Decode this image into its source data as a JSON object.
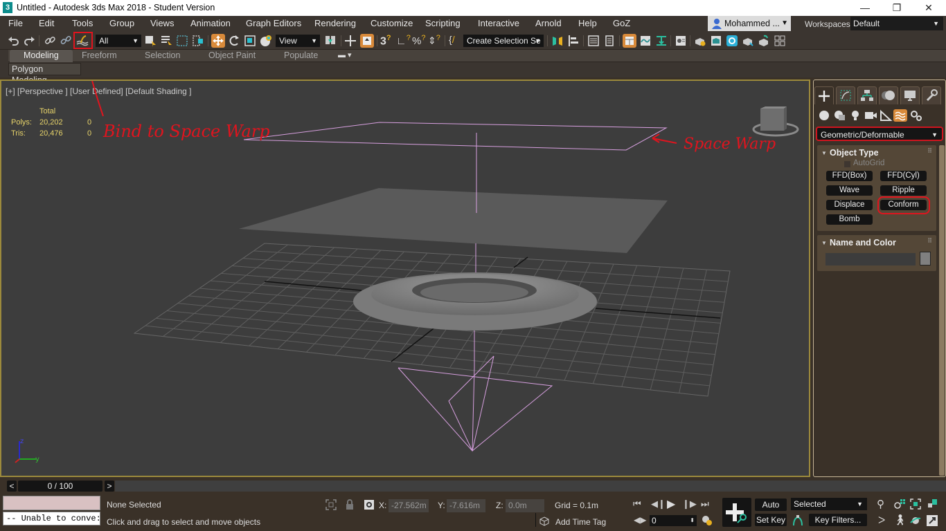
{
  "window": {
    "title": "Untitled - Autodesk 3ds Max 2018 - Student Version",
    "app_icon": "3",
    "minimize": "—",
    "restore": "❐",
    "close": "✕"
  },
  "menu": {
    "items": [
      "File",
      "Edit",
      "Tools",
      "Group",
      "Views",
      "Animation",
      "Graph Editors",
      "Rendering",
      "Customize",
      "Scripting",
      "Interactive",
      "Arnold",
      "Help",
      "GoZ"
    ],
    "user": "Mohammed ...",
    "workspaces_label": "Workspaces:",
    "workspace_value": "Default"
  },
  "toolbar": {
    "selection_filter": "All",
    "ref_coord": "View",
    "named_selection": "Create Selection Se",
    "highlighted_tool": "bind-to-space-warp"
  },
  "ribbon": {
    "tabs": [
      "Modeling",
      "Freeform",
      "Selection",
      "Object Paint",
      "Populate"
    ],
    "active_tab": "Modeling",
    "panel_button": "Polygon Modeling"
  },
  "viewport": {
    "label": "[+] [Perspective ] [User Defined] [Default Shading ]",
    "stats": {
      "header": "Total",
      "rows": [
        {
          "label": "Polys:",
          "total": "20,202",
          "selected": "0"
        },
        {
          "label": "Tris:",
          "total": "20,476",
          "selected": "0"
        }
      ]
    },
    "annotations": {
      "bind": "Bind to Space Warp",
      "warp": "Space Warp"
    },
    "axis": {
      "z": "z",
      "y": "y"
    }
  },
  "command_panel": {
    "category_dropdown": "Geometric/Deformable",
    "object_type": {
      "title": "Object Type",
      "autogrid": "AutoGrid",
      "buttons": [
        "FFD(Box)",
        "FFD(Cyl)",
        "Wave",
        "Ripple",
        "Displace",
        "Conform",
        "Bomb"
      ],
      "highlighted": "Conform"
    },
    "name_color": {
      "title": "Name and Color",
      "name_value": "",
      "swatch_color": "#808080"
    }
  },
  "timeline": {
    "frame": "0 / 100",
    "prev": "<",
    "next": ">"
  },
  "status": {
    "maxscript_output": "-- Unable to conve:",
    "selection": "None Selected",
    "prompt": "Click and drag to select and move objects",
    "x_label": "X:",
    "x_value": "-27.562m",
    "y_label": "Y:",
    "y_value": "-7.616m",
    "z_label": "Z:",
    "z_value": "0.0m",
    "grid": "Grid = 0.1m",
    "add_time_tag": "Add Time Tag",
    "auto_key": "Auto Key",
    "set_key": "Set Key",
    "key_mode": "Selected",
    "key_filters": "Key Filters...",
    "current_frame": "0"
  },
  "colors": {
    "accent_orange": "#d98a3a",
    "annotation_red": "#e0141e",
    "spacewarp_pink": "#d8a0e0",
    "viewport_border": "#9c8a3c"
  }
}
